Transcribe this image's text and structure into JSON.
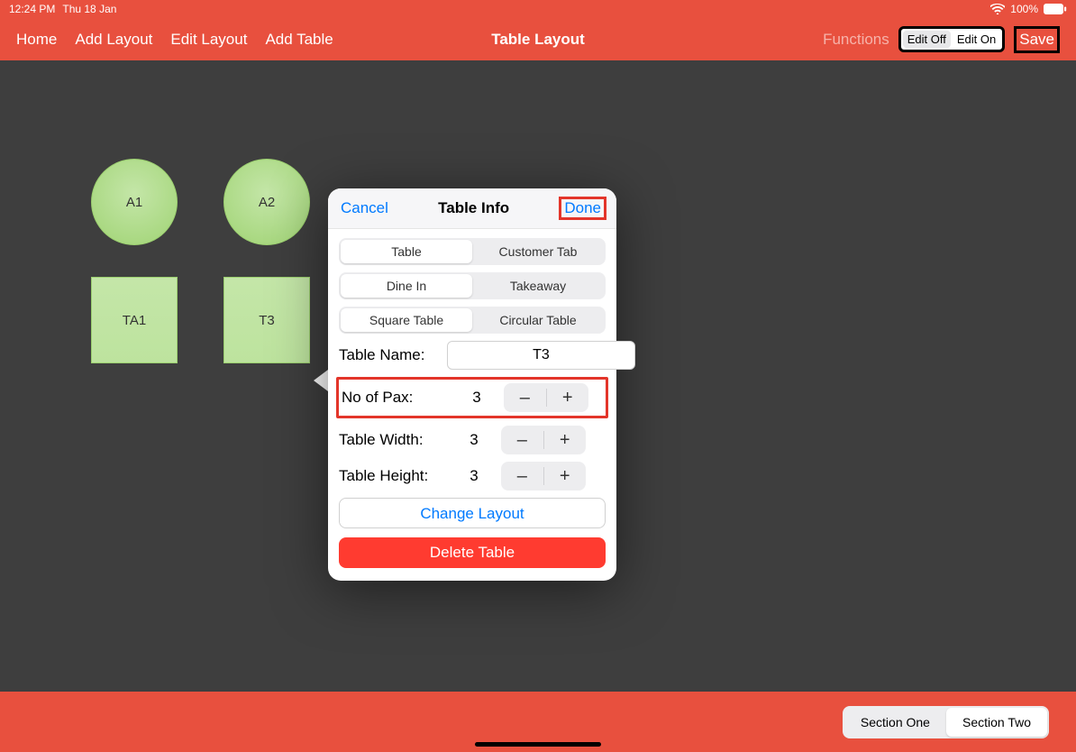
{
  "status": {
    "time": "12:24 PM",
    "date": "Thu 18 Jan",
    "battery": "100%"
  },
  "nav": {
    "home": "Home",
    "addLayout": "Add Layout",
    "editLayout": "Edit Layout",
    "addTable": "Add Table",
    "title": "Table Layout",
    "functions": "Functions",
    "editOff": "Edit Off",
    "editOn": "Edit On",
    "save": "Save"
  },
  "tables": {
    "a1": "A1",
    "a2": "A2",
    "ta1": "TA1",
    "t3": "T3"
  },
  "popover": {
    "cancel": "Cancel",
    "title": "Table Info",
    "done": "Done",
    "seg1": {
      "a": "Table",
      "b": "Customer Tab"
    },
    "seg2": {
      "a": "Dine In",
      "b": "Takeaway"
    },
    "seg3": {
      "a": "Square Table",
      "b": "Circular Table"
    },
    "tableNameLabel": "Table Name:",
    "tableNameValue": "T3",
    "paxLabel": "No of Pax:",
    "paxValue": "3",
    "widthLabel": "Table Width:",
    "widthValue": "3",
    "heightLabel": "Table Height:",
    "heightValue": "3",
    "minus": "–",
    "plus": "+",
    "changeLayout": "Change Layout",
    "deleteTable": "Delete Table"
  },
  "sections": {
    "one": "Section One",
    "two": "Section Two"
  }
}
